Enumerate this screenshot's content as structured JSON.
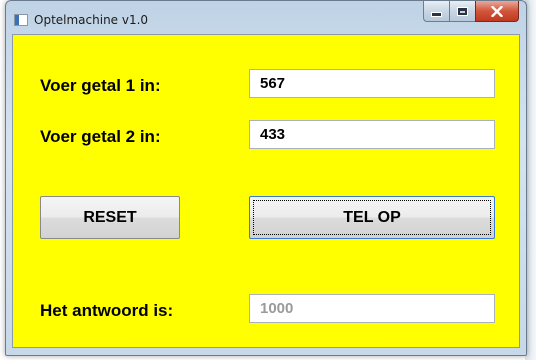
{
  "window": {
    "title": "Optelmachine v1.0"
  },
  "form": {
    "label1": "Voer getal 1 in:",
    "input1": "567",
    "label2": "Voer getal 2 in:",
    "input2": "433",
    "reset_button": "RESET",
    "add_button": "TEL OP",
    "answer_label": "Het antwoord is:",
    "answer_value": "1000"
  },
  "colors": {
    "background": "#ffff00"
  }
}
